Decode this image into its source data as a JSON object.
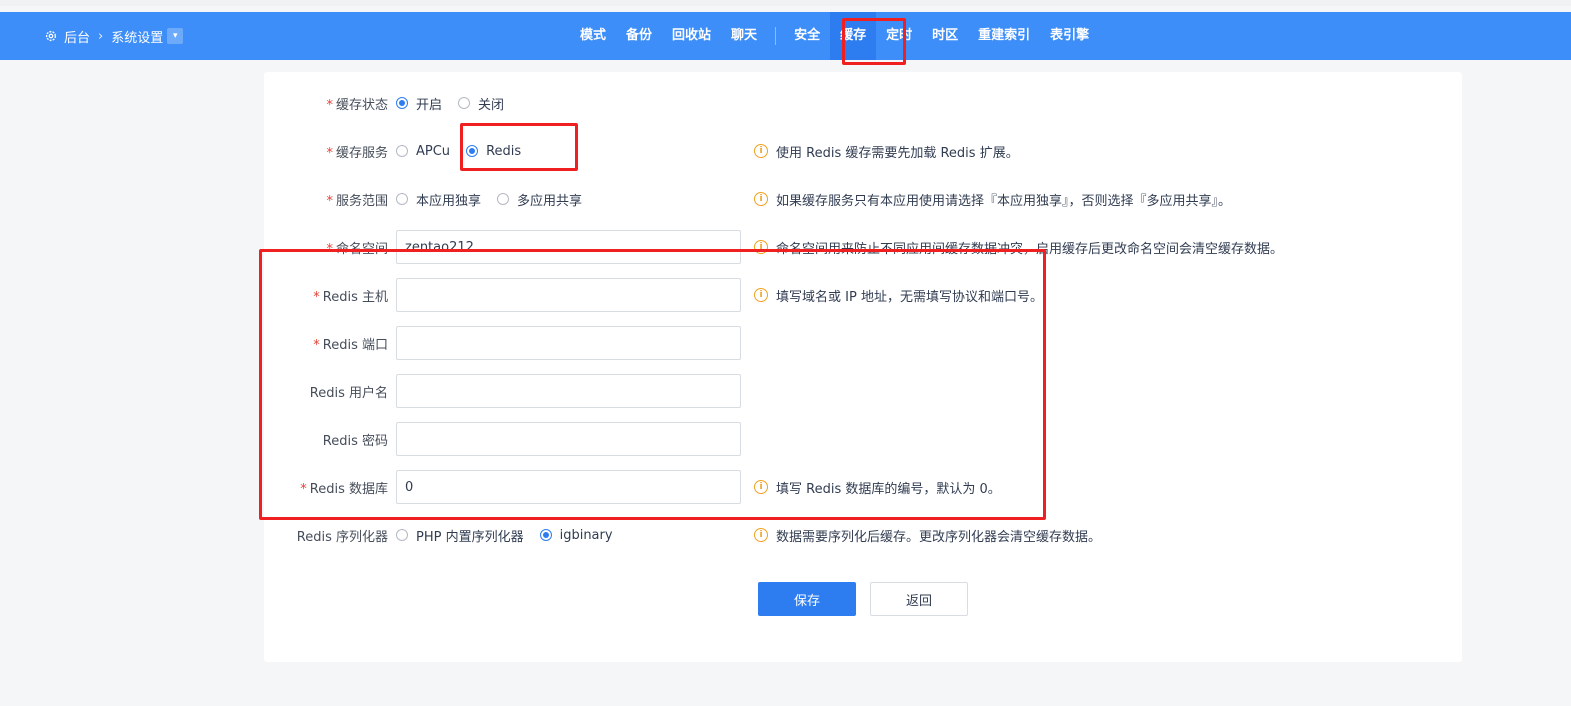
{
  "breadcrumb": {
    "root": "后台",
    "current": "系统设置"
  },
  "menu": [
    "模式",
    "备份",
    "回收站",
    "聊天",
    "安全",
    "缓存",
    "定时",
    "时区",
    "重建索引",
    "表引擎"
  ],
  "menu_active": "缓存",
  "form": {
    "cache_status": {
      "label": "缓存状态",
      "options": [
        "开启",
        "关闭"
      ],
      "selected": "开启"
    },
    "cache_service": {
      "label": "缓存服务",
      "options": [
        "APCu",
        "Redis"
      ],
      "selected": "Redis",
      "tip": "使用 Redis 缓存需要先加载 Redis 扩展。"
    },
    "scope": {
      "label": "服务范围",
      "options": [
        "本应用独享",
        "多应用共享"
      ],
      "tip": "如果缓存服务只有本应用使用请选择『本应用独享』，否则选择『多应用共享』。"
    },
    "namespace": {
      "label": "命名空间",
      "value": "zentao212",
      "tip": "命名空间用来防止不同应用间缓存数据冲突，启用缓存后更改命名空间会清空缓存数据。"
    },
    "redis_host": {
      "label": "Redis 主机",
      "value": "",
      "tip": "填写域名或 IP 地址，无需填写协议和端口号。"
    },
    "redis_port": {
      "label": "Redis 端口",
      "value": ""
    },
    "redis_user": {
      "label": "Redis 用户名",
      "value": ""
    },
    "redis_password": {
      "label": "Redis 密码",
      "value": ""
    },
    "redis_db": {
      "label": "Redis 数据库",
      "value": "0",
      "tip": "填写 Redis 数据库的编号，默认为 0。"
    },
    "serializer": {
      "label": "Redis 序列化器",
      "options": [
        "PHP 内置序列化器",
        "igbinary"
      ],
      "selected": "igbinary",
      "tip": "数据需要序列化后缓存。更改序列化器会清空缓存数据。"
    }
  },
  "buttons": {
    "save": "保存",
    "back": "返回"
  },
  "colors": {
    "accent": "#2e7df0",
    "navbar": "#3d8ef8",
    "highlight": "#f02020",
    "warning": "#f0a020"
  }
}
